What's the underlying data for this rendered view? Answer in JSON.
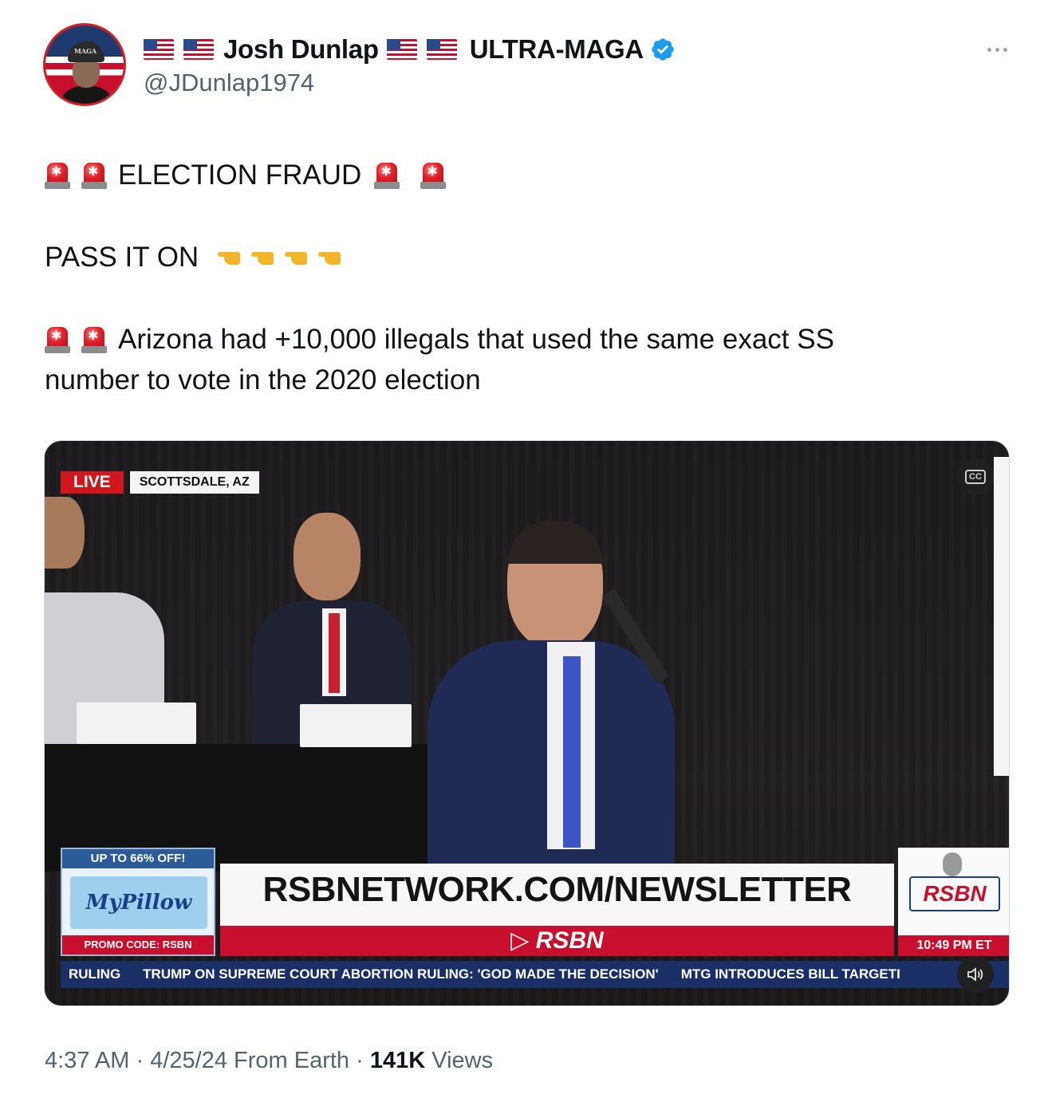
{
  "author": {
    "display_name": "Josh Dunlap",
    "name_suffix": "ULTRA-MAGA",
    "handle": "@JDunlap1974",
    "verified": true,
    "avatar_cap_text": "MAGA"
  },
  "tweet": {
    "line1_text": "ELECTION FRAUD",
    "line2_text": "PASS IT ON",
    "line3_text": "Arizona had +10,000 illegals that used the same exact SS",
    "line4_text": "number to  vote in the 2020 election"
  },
  "video": {
    "live_label": "LIVE",
    "location": "SCOTTSDALE, AZ",
    "promo_top": "UP TO 66% OFF!",
    "promo_logo": "MyPillow",
    "promo_code": "PROMO CODE: RSBN",
    "headline": "RSBNETWORK.COM/NEWSLETTER",
    "network_bar": "RSBN",
    "logo": "RSBN",
    "time": "10:49 PM ET",
    "ticker": [
      "RULING",
      "TRUMP ON SUPREME COURT ABORTION RULING: 'GOD MADE THE DECISION'",
      "MTG INTRODUCES BILL TARGETI"
    ],
    "cc_label": "CC"
  },
  "meta": {
    "time": "4:37 AM",
    "date": "4/25/24",
    "source": "From Earth",
    "views_count": "141K",
    "views_label": "Views",
    "separator": "·"
  },
  "colors": {
    "verified_blue": "#1d9bf0",
    "secondary_text": "#536471",
    "siren_red": "#e0202b",
    "rsbn_red": "#c8102e"
  },
  "icons": [
    "us-flag-icon",
    "verified-badge-icon",
    "more-options-icon",
    "police-siren-icon",
    "pointing-left-icon",
    "closed-captions-icon",
    "volume-icon"
  ]
}
